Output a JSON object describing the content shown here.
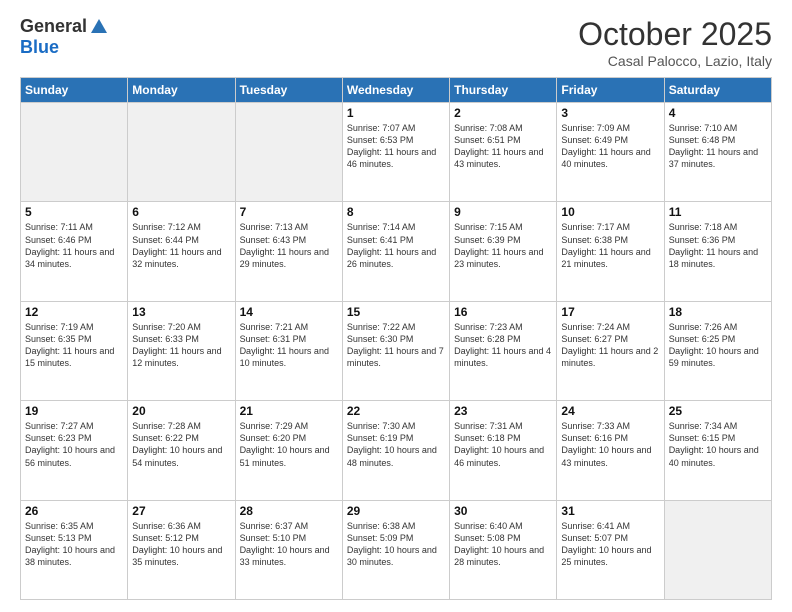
{
  "header": {
    "logo_general": "General",
    "logo_blue": "Blue",
    "month_title": "October 2025",
    "location": "Casal Palocco, Lazio, Italy"
  },
  "days_of_week": [
    "Sunday",
    "Monday",
    "Tuesday",
    "Wednesday",
    "Thursday",
    "Friday",
    "Saturday"
  ],
  "weeks": [
    [
      {
        "day": "",
        "info": ""
      },
      {
        "day": "",
        "info": ""
      },
      {
        "day": "",
        "info": ""
      },
      {
        "day": "1",
        "info": "Sunrise: 7:07 AM\nSunset: 6:53 PM\nDaylight: 11 hours and 46 minutes."
      },
      {
        "day": "2",
        "info": "Sunrise: 7:08 AM\nSunset: 6:51 PM\nDaylight: 11 hours and 43 minutes."
      },
      {
        "day": "3",
        "info": "Sunrise: 7:09 AM\nSunset: 6:49 PM\nDaylight: 11 hours and 40 minutes."
      },
      {
        "day": "4",
        "info": "Sunrise: 7:10 AM\nSunset: 6:48 PM\nDaylight: 11 hours and 37 minutes."
      }
    ],
    [
      {
        "day": "5",
        "info": "Sunrise: 7:11 AM\nSunset: 6:46 PM\nDaylight: 11 hours and 34 minutes."
      },
      {
        "day": "6",
        "info": "Sunrise: 7:12 AM\nSunset: 6:44 PM\nDaylight: 11 hours and 32 minutes."
      },
      {
        "day": "7",
        "info": "Sunrise: 7:13 AM\nSunset: 6:43 PM\nDaylight: 11 hours and 29 minutes."
      },
      {
        "day": "8",
        "info": "Sunrise: 7:14 AM\nSunset: 6:41 PM\nDaylight: 11 hours and 26 minutes."
      },
      {
        "day": "9",
        "info": "Sunrise: 7:15 AM\nSunset: 6:39 PM\nDaylight: 11 hours and 23 minutes."
      },
      {
        "day": "10",
        "info": "Sunrise: 7:17 AM\nSunset: 6:38 PM\nDaylight: 11 hours and 21 minutes."
      },
      {
        "day": "11",
        "info": "Sunrise: 7:18 AM\nSunset: 6:36 PM\nDaylight: 11 hours and 18 minutes."
      }
    ],
    [
      {
        "day": "12",
        "info": "Sunrise: 7:19 AM\nSunset: 6:35 PM\nDaylight: 11 hours and 15 minutes."
      },
      {
        "day": "13",
        "info": "Sunrise: 7:20 AM\nSunset: 6:33 PM\nDaylight: 11 hours and 12 minutes."
      },
      {
        "day": "14",
        "info": "Sunrise: 7:21 AM\nSunset: 6:31 PM\nDaylight: 11 hours and 10 minutes."
      },
      {
        "day": "15",
        "info": "Sunrise: 7:22 AM\nSunset: 6:30 PM\nDaylight: 11 hours and 7 minutes."
      },
      {
        "day": "16",
        "info": "Sunrise: 7:23 AM\nSunset: 6:28 PM\nDaylight: 11 hours and 4 minutes."
      },
      {
        "day": "17",
        "info": "Sunrise: 7:24 AM\nSunset: 6:27 PM\nDaylight: 11 hours and 2 minutes."
      },
      {
        "day": "18",
        "info": "Sunrise: 7:26 AM\nSunset: 6:25 PM\nDaylight: 10 hours and 59 minutes."
      }
    ],
    [
      {
        "day": "19",
        "info": "Sunrise: 7:27 AM\nSunset: 6:23 PM\nDaylight: 10 hours and 56 minutes."
      },
      {
        "day": "20",
        "info": "Sunrise: 7:28 AM\nSunset: 6:22 PM\nDaylight: 10 hours and 54 minutes."
      },
      {
        "day": "21",
        "info": "Sunrise: 7:29 AM\nSunset: 6:20 PM\nDaylight: 10 hours and 51 minutes."
      },
      {
        "day": "22",
        "info": "Sunrise: 7:30 AM\nSunset: 6:19 PM\nDaylight: 10 hours and 48 minutes."
      },
      {
        "day": "23",
        "info": "Sunrise: 7:31 AM\nSunset: 6:18 PM\nDaylight: 10 hours and 46 minutes."
      },
      {
        "day": "24",
        "info": "Sunrise: 7:33 AM\nSunset: 6:16 PM\nDaylight: 10 hours and 43 minutes."
      },
      {
        "day": "25",
        "info": "Sunrise: 7:34 AM\nSunset: 6:15 PM\nDaylight: 10 hours and 40 minutes."
      }
    ],
    [
      {
        "day": "26",
        "info": "Sunrise: 6:35 AM\nSunset: 5:13 PM\nDaylight: 10 hours and 38 minutes."
      },
      {
        "day": "27",
        "info": "Sunrise: 6:36 AM\nSunset: 5:12 PM\nDaylight: 10 hours and 35 minutes."
      },
      {
        "day": "28",
        "info": "Sunrise: 6:37 AM\nSunset: 5:10 PM\nDaylight: 10 hours and 33 minutes."
      },
      {
        "day": "29",
        "info": "Sunrise: 6:38 AM\nSunset: 5:09 PM\nDaylight: 10 hours and 30 minutes."
      },
      {
        "day": "30",
        "info": "Sunrise: 6:40 AM\nSunset: 5:08 PM\nDaylight: 10 hours and 28 minutes."
      },
      {
        "day": "31",
        "info": "Sunrise: 6:41 AM\nSunset: 5:07 PM\nDaylight: 10 hours and 25 minutes."
      },
      {
        "day": "",
        "info": ""
      }
    ]
  ]
}
